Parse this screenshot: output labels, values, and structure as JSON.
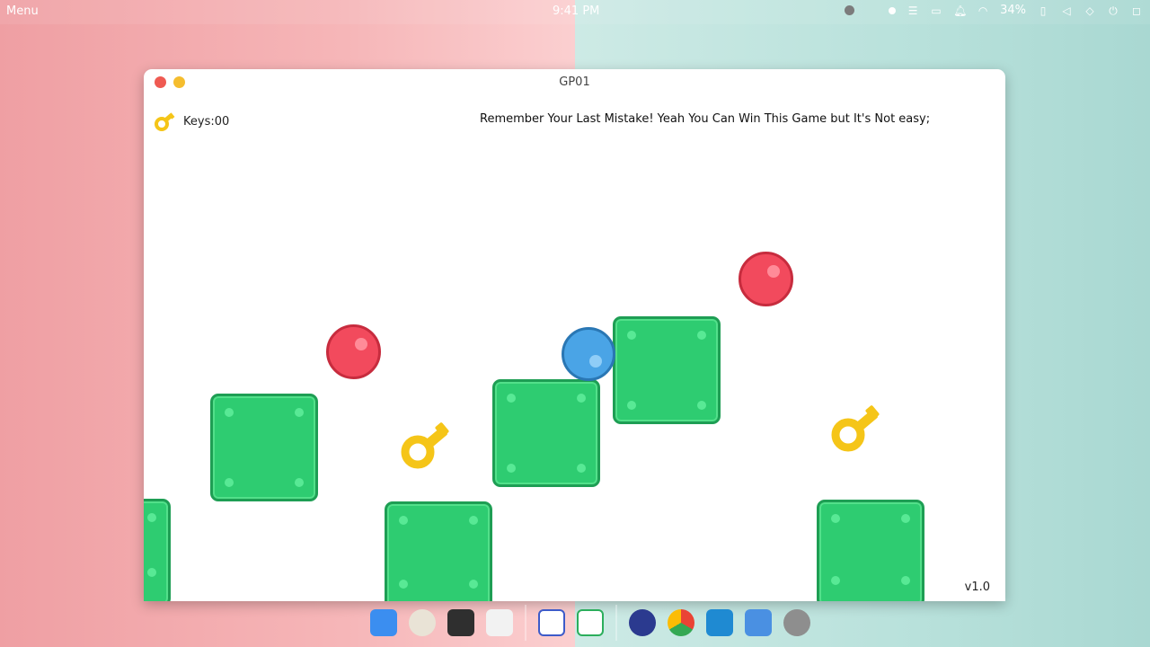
{
  "topbar": {
    "menu_label": "Menu",
    "clock": "9:41 PM",
    "battery": "34%"
  },
  "window": {
    "title": "GP01"
  },
  "hud": {
    "keys_label": "Keys:00",
    "message": "Remember Your Last Mistake!  Yeah You Can Win This Game but It's Not easy;",
    "version": "v1.0"
  },
  "colors": {
    "block_fill": "#2ecc71",
    "block_border": "#1e9e54",
    "enemy_ball": "#f24a5d",
    "player_ball": "#4aa4e6",
    "key": "#f5c518"
  },
  "dock_apps": [
    "app-store-icon",
    "music-icon",
    "terminal-icon",
    "text-editor-icon",
    "document-icon",
    "spreadsheet-icon",
    "system-monitor-icon",
    "chrome-icon",
    "vscode-icon",
    "files-icon",
    "settings-icon"
  ]
}
